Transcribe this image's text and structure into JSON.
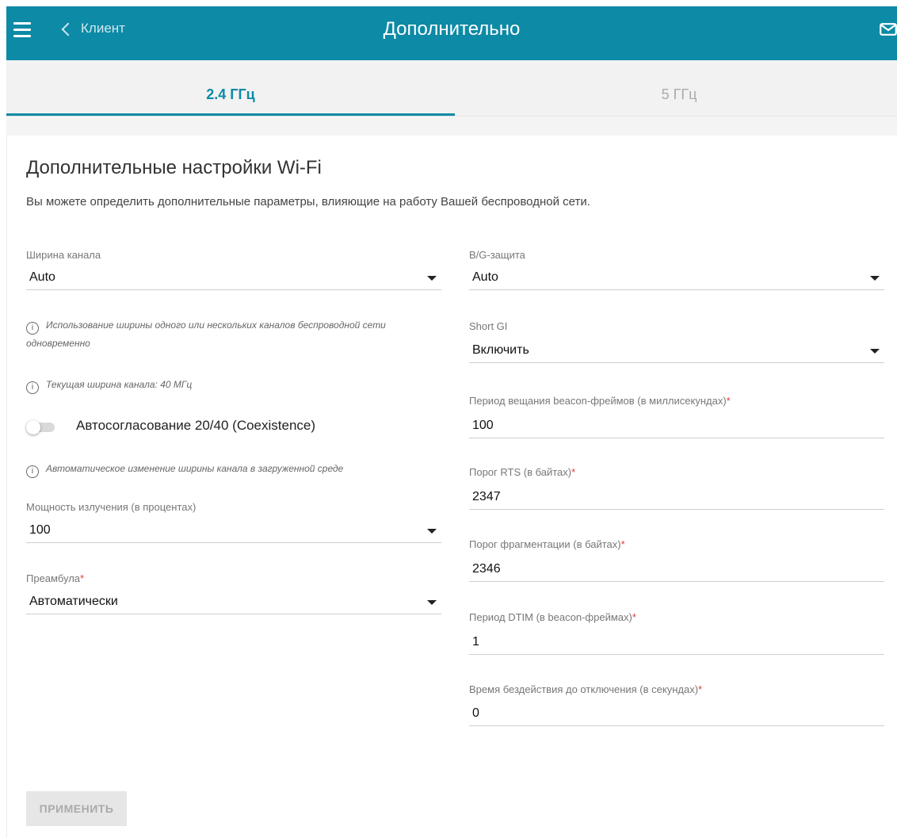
{
  "header": {
    "back_label": "Клиент",
    "title": "Дополнительно",
    "icons": [
      "menu-icon",
      "chevron-left-icon",
      "mail-icon"
    ],
    "accent_color": "#0d8aa6"
  },
  "tabs": [
    {
      "label": "2.4 ГГц",
      "active": true
    },
    {
      "label": "5 ГГц",
      "active": false
    }
  ],
  "section": {
    "title": "Дополнительные настройки Wi-Fi",
    "description": "Вы можете определить дополнительные параметры, влияющие на работу Вашей беспроводной сети."
  },
  "left": {
    "channel_width": {
      "label": "Ширина канала",
      "value": "Auto"
    },
    "hint_channel_usage": "Использование ширины одного или нескольких каналов беспроводной сети одновременно",
    "hint_current_width": "Текущая ширина канала: 40 МГц",
    "coexistence": {
      "label": "Автосогласование 20/40 (Coexistence)",
      "enabled": false
    },
    "hint_auto_change": "Автоматическое изменение ширины канала в загруженной среде",
    "tx_power": {
      "label": "Мощность излучения (в процентах)",
      "value": "100"
    },
    "preamble": {
      "label": "Преамбула",
      "required_mark": "*",
      "value": "Автоматически"
    }
  },
  "right": {
    "bg_protection": {
      "label": "B/G-защита",
      "value": "Auto"
    },
    "short_gi": {
      "label": "Short GI",
      "value": "Включить"
    },
    "beacon_period": {
      "label": "Период вещания beacon-фреймов (в миллисекундах)",
      "required_mark": "*",
      "value": "100"
    },
    "rts_threshold": {
      "label": "Порог RTS (в байтах)",
      "required_mark": "*",
      "value": "2347"
    },
    "frag_threshold": {
      "label": "Порог фрагментации (в байтах)",
      "required_mark": "*",
      "value": "2346"
    },
    "dtim_period": {
      "label": "Период DTIM (в beacon-фреймах)",
      "required_mark": "*",
      "value": "1"
    },
    "inactivity_time": {
      "label": "Время бездействия до отключения (в секундах)",
      "required_mark": "*",
      "value": "0"
    }
  },
  "apply_label": "ПРИМЕНИТЬ"
}
